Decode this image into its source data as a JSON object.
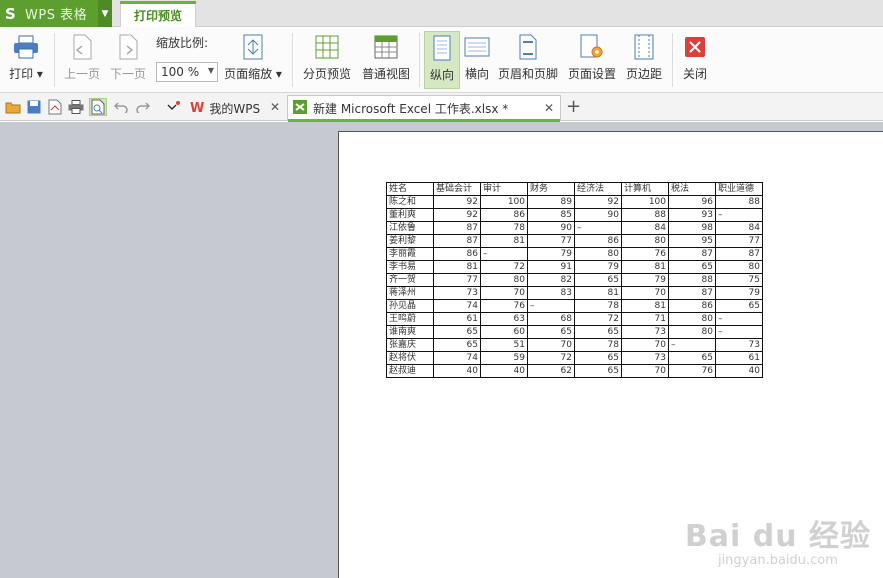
{
  "app": {
    "name": "WPS 表格",
    "logo": "S",
    "accent": "#5d9f2f"
  },
  "ribbon_tab": "打印预览",
  "ribbon": {
    "print": "打印",
    "prev_page": "上一页",
    "next_page": "下一页",
    "zoom_label": "缩放比例:",
    "zoom_value": "100 %",
    "page_zoom": "页面缩放",
    "page_break_preview": "分页预览",
    "normal_view": "普通视图",
    "portrait": "纵向",
    "landscape": "横向",
    "header_footer": "页眉和页脚",
    "page_setup": "页面设置",
    "margins": "页边距",
    "close": "关闭"
  },
  "doc_tabs": [
    {
      "label": "我的WPS"
    },
    {
      "label": "新建 Microsoft Excel 工作表.xlsx *"
    }
  ],
  "sheet": {
    "headers": [
      "姓名",
      "基础会计",
      "审计",
      "财务",
      "经济法",
      "计算机",
      "税法",
      "职业道德"
    ],
    "rows": [
      [
        "陈之和",
        "92",
        "100",
        "89",
        "92",
        "100",
        "96",
        "88"
      ],
      [
        "董利爽",
        "92",
        "86",
        "85",
        "90",
        "88",
        "93",
        "–"
      ],
      [
        "江依鲁",
        "87",
        "78",
        "90",
        "–",
        "84",
        "98",
        "84"
      ],
      [
        "姜利黎",
        "87",
        "81",
        "77",
        "86",
        "80",
        "95",
        "77"
      ],
      [
        "李丽霞",
        "86",
        "–",
        "79",
        "80",
        "76",
        "87",
        "87"
      ],
      [
        "李书易",
        "81",
        "72",
        "91",
        "79",
        "81",
        "65",
        "80"
      ],
      [
        "齐一贺",
        "77",
        "80",
        "82",
        "65",
        "79",
        "88",
        "75"
      ],
      [
        "蒋泽州",
        "73",
        "70",
        "83",
        "81",
        "70",
        "87",
        "79"
      ],
      [
        "孙见晶",
        "74",
        "76",
        "–",
        "78",
        "81",
        "86",
        "65"
      ],
      [
        "王鸣蔚",
        "61",
        "63",
        "68",
        "72",
        "71",
        "80",
        "–"
      ],
      [
        "谁南爽",
        "65",
        "60",
        "65",
        "65",
        "73",
        "80",
        "–"
      ],
      [
        "张嘉庆",
        "65",
        "51",
        "70",
        "78",
        "70",
        "–",
        "73"
      ],
      [
        "赵将伏",
        "74",
        "59",
        "72",
        "65",
        "73",
        "65",
        "61"
      ],
      [
        "赵叔迪",
        "40",
        "40",
        "62",
        "65",
        "70",
        "76",
        "40"
      ]
    ]
  },
  "watermark": {
    "main": "Bai du 经验",
    "sub": "jingyan.baidu.com"
  }
}
